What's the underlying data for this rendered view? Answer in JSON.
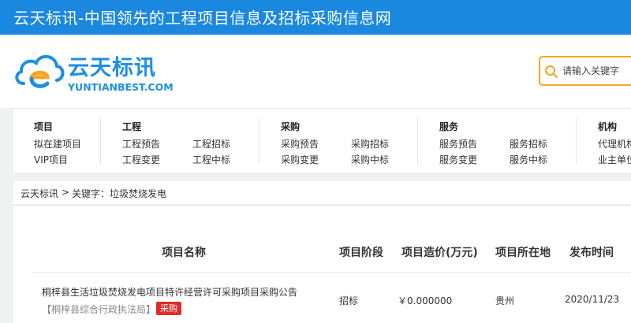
{
  "site": {
    "title": "云天标讯-中国领先的工程项目信息及招标采购信息网",
    "logo_cn": "云天标讯",
    "logo_en": "YUNTIANBEST.COM"
  },
  "search": {
    "placeholder": "请输入关键字",
    "icon": "search-icon"
  },
  "nav": {
    "groups": [
      {
        "head": "项目",
        "links": [
          "拟在建项目",
          "VIP项目"
        ]
      },
      {
        "head": "工程",
        "links": [
          "工程预告",
          "工程招标",
          "工程变更",
          "工程中标"
        ]
      },
      {
        "head": "采购",
        "links": [
          "采购预告",
          "采购招标",
          "采购变更",
          "采购中标"
        ]
      },
      {
        "head": "服务",
        "links": [
          "服务预告",
          "服务招标",
          "服务变更",
          "服务中标"
        ]
      },
      {
        "head": "机构",
        "links": [
          "代理机构",
          "业主单位"
        ]
      }
    ]
  },
  "breadcrumb": {
    "home": "云天标讯",
    "sep": ">",
    "current": "关键字：垃圾焚烧发电"
  },
  "table": {
    "headers": [
      "项目名称",
      "项目阶段",
      "项目造价(万元)",
      "项目所在地",
      "发布时间"
    ],
    "rows": [
      {
        "title": "桐梓县生活垃圾焚烧发电项目特许经营许可采购项目采购公告",
        "org": "【桐梓县综合行政执法局】",
        "tag": "采购",
        "stage": "招标",
        "cost": "￥0.000000",
        "location": "贵州",
        "date": "2020/11/23"
      }
    ]
  },
  "colors": {
    "brand_blue": "#1a88de",
    "search_border": "#f5a623",
    "tag_red": "#e02b2b"
  }
}
